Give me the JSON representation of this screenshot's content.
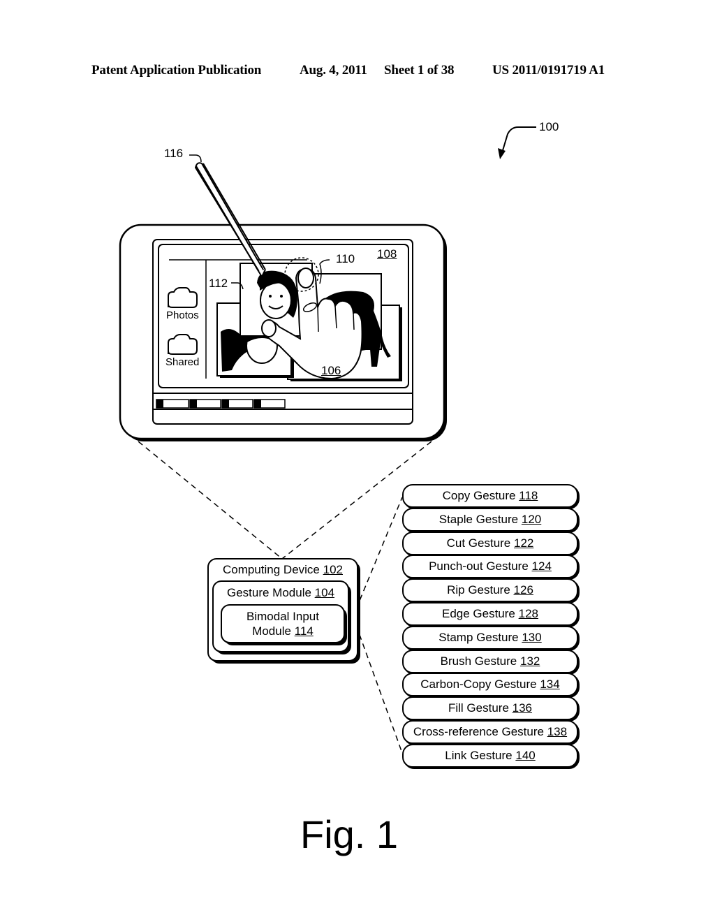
{
  "header": {
    "publication": "Patent Application Publication",
    "date": "Aug. 4, 2011",
    "sheet": "Sheet 1 of 38",
    "number": "US 2011/0191719 A1"
  },
  "refs": {
    "system": "100",
    "stylus": "116",
    "display": "108",
    "finger_contact": "110",
    "selected_image": "112",
    "hand": "106"
  },
  "device_screen": {
    "sidebar_items": [
      {
        "label": "Photos",
        "icon": "folder-icon"
      },
      {
        "label": "Shared",
        "icon": "folder-icon"
      }
    ],
    "taskbar_buttons": 4
  },
  "computing_device": {
    "label": "Computing Device",
    "ref": "102",
    "gesture_module": {
      "label": "Gesture Module",
      "ref": "104",
      "bimodal": {
        "line1": "Bimodal Input",
        "line2": "Module",
        "ref": "114"
      }
    }
  },
  "gestures": [
    {
      "label": "Copy Gesture",
      "ref": "118"
    },
    {
      "label": "Staple Gesture",
      "ref": "120"
    },
    {
      "label": "Cut Gesture",
      "ref": "122"
    },
    {
      "label": "Punch-out Gesture",
      "ref": "124"
    },
    {
      "label": "Rip Gesture",
      "ref": "126"
    },
    {
      "label": "Edge Gesture",
      "ref": "128"
    },
    {
      "label": "Stamp Gesture",
      "ref": "130"
    },
    {
      "label": "Brush Gesture",
      "ref": "132"
    },
    {
      "label": "Carbon-Copy Gesture",
      "ref": "134"
    },
    {
      "label": "Fill Gesture",
      "ref": "136"
    },
    {
      "label": "Cross-reference Gesture",
      "ref": "138"
    },
    {
      "label": "Link Gesture",
      "ref": "140"
    }
  ],
  "figure_caption": "Fig. 1"
}
